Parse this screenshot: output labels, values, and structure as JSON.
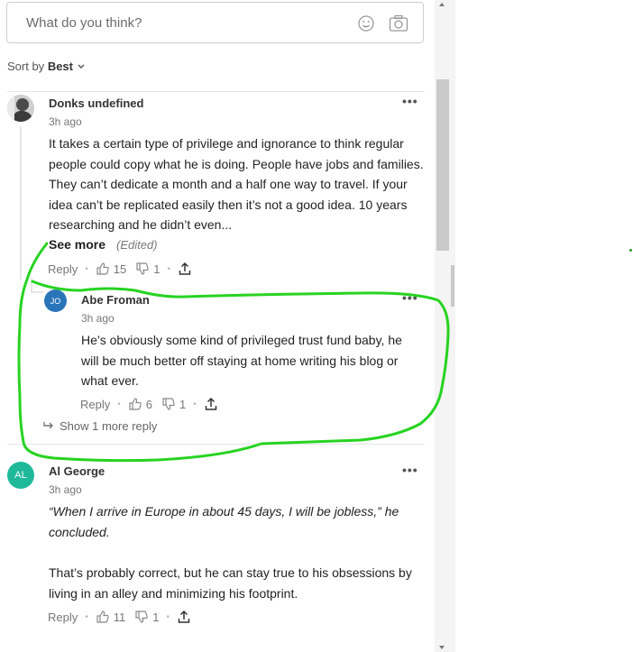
{
  "comment_box": {
    "placeholder": "What do you think?"
  },
  "sort": {
    "label": "Sort by",
    "value": "Best"
  },
  "comments": [
    {
      "name": "Donks undefined",
      "time": "3h ago",
      "text": "It takes a certain type of privilege and ignorance to think regular people could copy what he is doing. People have jobs and families. They can’t dedicate a month and a half one way to travel. If your idea can’t be replicated easily then it’s not a good idea. 10 years researching and he didn’t even...",
      "see_more": "See more",
      "edited": "(Edited)",
      "reply": "Reply",
      "likes": "15",
      "dislikes": "1"
    },
    {
      "initials": "JO",
      "name": "Abe Froman",
      "time": "3h ago",
      "text": "He’s obviously some kind of privileged trust fund baby, he will be  much better off staying at home writing his blog or what ever.",
      "reply": "Reply",
      "likes": "6",
      "dislikes": "1",
      "show_more": "Show 1 more reply"
    },
    {
      "initials": "AL",
      "name": "Al George",
      "time": "3h ago",
      "quote": "“When I arrive in Europe in about 45 days, I will be jobless,” he concluded.",
      "text": "That’s probably correct, but he can stay true to his obsessions by living in an alley and minimizing his footprint.",
      "reply": "Reply",
      "likes": "11",
      "dislikes": "1"
    }
  ],
  "colors": {
    "accent_jo": "#2a74b8",
    "accent_al": "#1fb99a",
    "annotation": "#27d321"
  }
}
